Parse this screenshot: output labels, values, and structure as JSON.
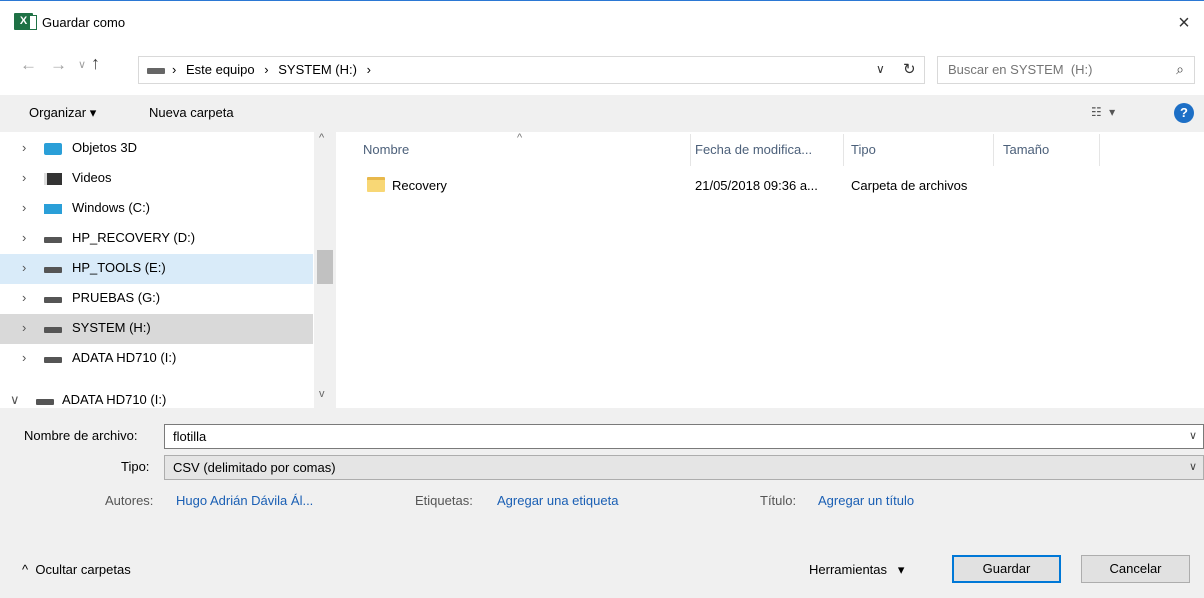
{
  "window": {
    "title": "Guardar como",
    "app_icon_letter": "X",
    "close_glyph": "×"
  },
  "address": {
    "crumbs": [
      "Este equipo",
      "SYSTEM  (H:)"
    ],
    "separator": "›",
    "search_placeholder": "Buscar en SYSTEM  (H:)"
  },
  "toolbar": {
    "organize_label": "Organizar ▾",
    "new_folder_label": "Nueva carpeta",
    "help_label": "?"
  },
  "nav_tree": {
    "items": [
      {
        "label": "Objetos 3D",
        "icon": "cube-icon",
        "state": "normal"
      },
      {
        "label": "Videos",
        "icon": "film-icon",
        "state": "normal"
      },
      {
        "label": "Windows (C:)",
        "icon": "windows-drive-icon",
        "state": "normal"
      },
      {
        "label": "HP_RECOVERY (D:)",
        "icon": "drive-icon",
        "state": "normal"
      },
      {
        "label": "HP_TOOLS (E:)",
        "icon": "drive-icon",
        "state": "hover"
      },
      {
        "label": "PRUEBAS (G:)",
        "icon": "drive-icon",
        "state": "normal"
      },
      {
        "label": "SYSTEM  (H:)",
        "icon": "drive-icon",
        "state": "selected"
      },
      {
        "label": "ADATA HD710 (I:)",
        "icon": "drive-icon",
        "state": "normal"
      },
      {
        "label": "ADATA HD710 (I:)",
        "icon": "drive-icon",
        "state": "expanded"
      }
    ]
  },
  "file_list": {
    "columns": [
      "Nombre",
      "Fecha de modifica...",
      "Tipo",
      "Tamaño"
    ],
    "rows": [
      {
        "name": "Recovery",
        "date": "21/05/2018 09:36 a...",
        "type": "Carpeta de archivos",
        "size": ""
      }
    ]
  },
  "form": {
    "filename_label": "Nombre de archivo:",
    "filename_value": "flotilla",
    "type_label": "Tipo:",
    "type_value": "CSV (delimitado por comas)",
    "authors_label": "Autores:",
    "authors_value": "Hugo Adrián Dávila Ál...",
    "tags_label": "Etiquetas:",
    "tags_value": "Agregar una etiqueta",
    "title_label": "Título:",
    "title_value": "Agregar un título"
  },
  "footer": {
    "hide_folders_label": "Ocultar carpetas",
    "tools_label": "Herramientas",
    "save_label": "Guardar",
    "cancel_label": "Cancelar"
  },
  "colors": {
    "accent": "#0078d7",
    "link": "#1a5fb4",
    "excel_green": "#1e7145",
    "hover_row": "#d9ebf9",
    "selected_row": "#d9d9d9"
  }
}
